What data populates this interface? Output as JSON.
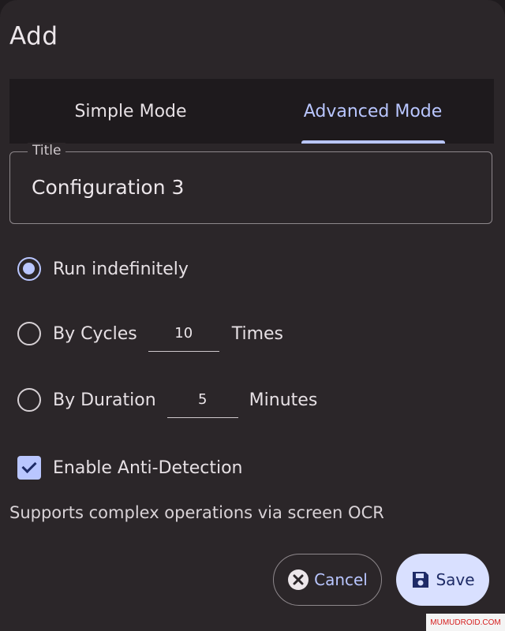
{
  "dialog": {
    "title": "Add",
    "tabs": [
      {
        "label": "Simple Mode",
        "active": false
      },
      {
        "label": "Advanced Mode",
        "active": true
      }
    ],
    "title_field": {
      "label": "Title",
      "value": "Configuration 3"
    },
    "options": {
      "run_indefinitely": {
        "label": "Run indefinitely",
        "selected": true
      },
      "by_cycles": {
        "label": "By Cycles",
        "value": "10",
        "unit": "Times",
        "selected": false
      },
      "by_duration": {
        "label": "By Duration",
        "value": "5",
        "unit": "Minutes",
        "selected": false
      }
    },
    "anti_detection": {
      "label": "Enable Anti-Detection",
      "checked": true
    },
    "note": "Supports complex operations via screen OCR",
    "buttons": {
      "cancel": "Cancel",
      "save": "Save"
    }
  },
  "watermark": "MUMUDROID.COM",
  "colors": {
    "accent": "#b9c6ff",
    "surface": "#2b2629",
    "save_bg": "#d9e0ff"
  },
  "icons": {
    "cancel": "close-circle-icon",
    "save": "save-icon"
  }
}
